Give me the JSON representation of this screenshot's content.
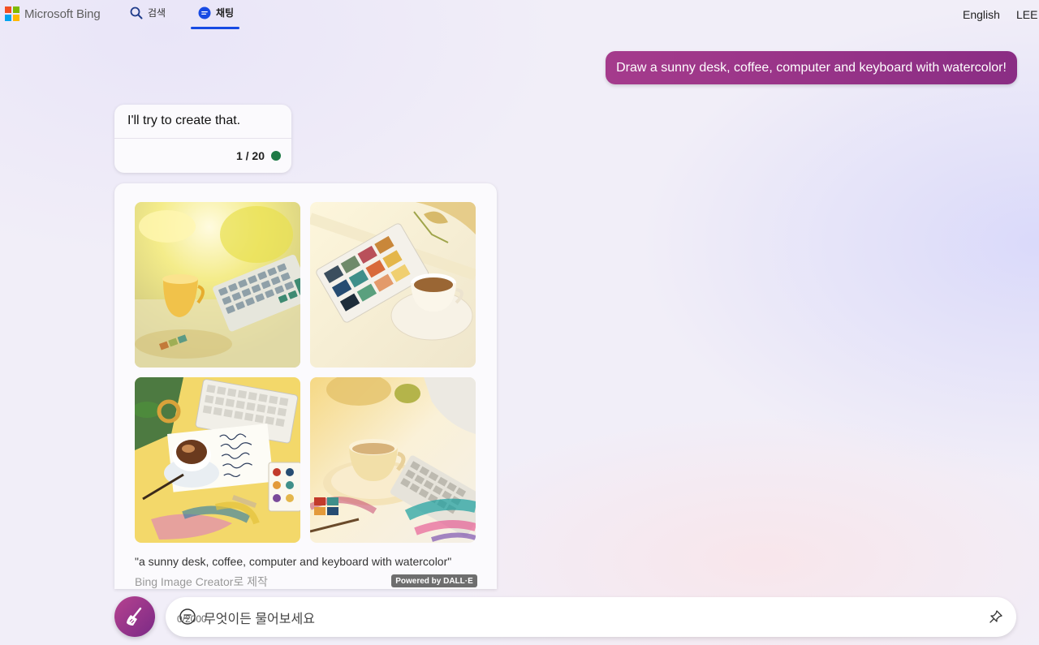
{
  "header": {
    "brand": "Microsoft Bing",
    "tabs": [
      {
        "label": "검색",
        "icon": "search-icon",
        "active": false
      },
      {
        "label": "채팅",
        "icon": "chat-icon",
        "active": true
      }
    ],
    "language": "English",
    "user": "LEE"
  },
  "conversation": {
    "user_message": "Draw a sunny desk, coffee, computer and keyboard with watercolor!",
    "bot_message": "I'll try to create that.",
    "turn_counter": "1 / 20",
    "image_result": {
      "image_count": 4,
      "caption": "\"a sunny desk, coffee, computer and keyboard with watercolor\"",
      "creator_label": "Bing Image Creator로 제작",
      "badge": "Powered by DALL·E"
    }
  },
  "composer": {
    "placeholder": "무엇이든 물어보세요",
    "char_count": "0/2000",
    "new_topic_icon": "broom-icon",
    "pin_icon": "pin-icon"
  },
  "colors": {
    "accent": "#174ae4",
    "user_bubble": "#9a3489",
    "status_dot": "#1e7a46"
  }
}
